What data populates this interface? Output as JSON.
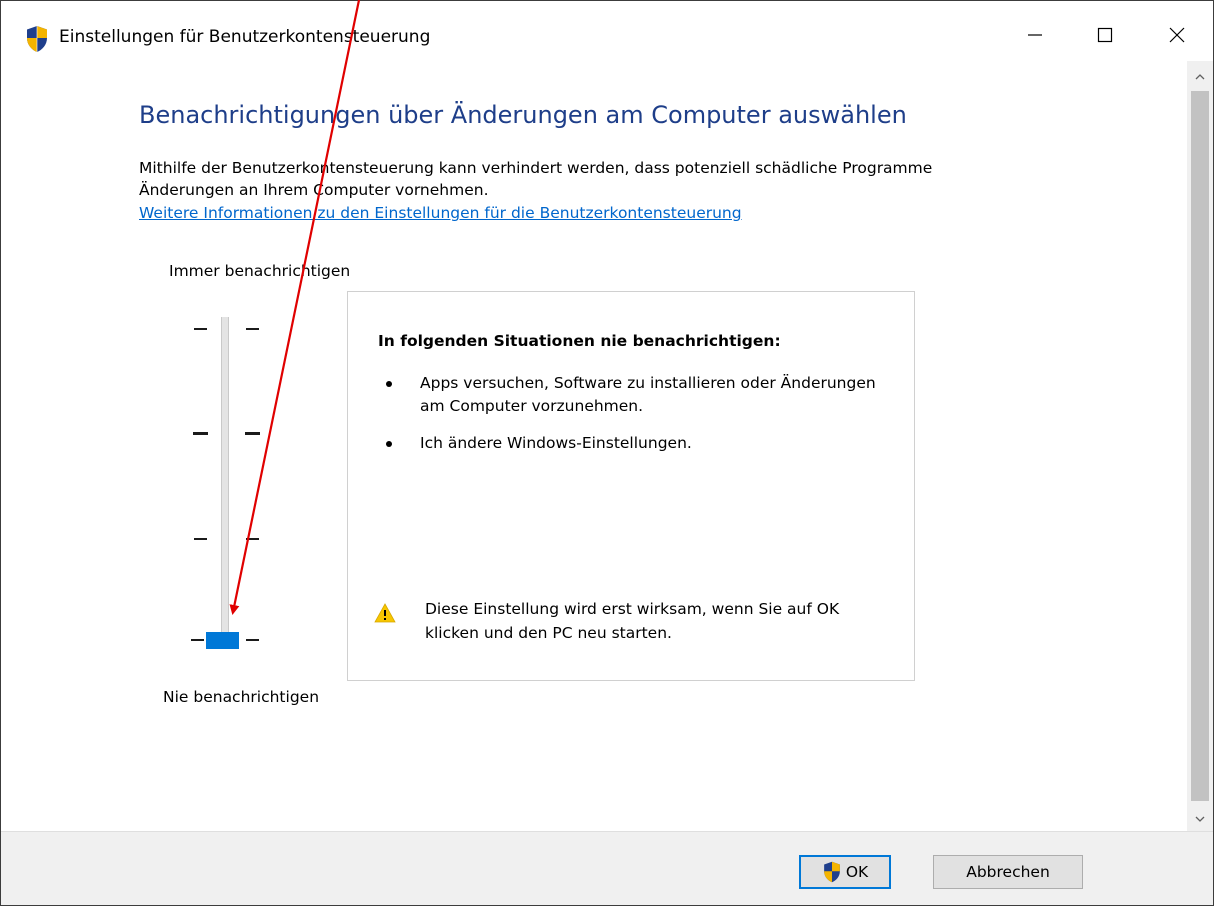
{
  "window": {
    "title": "Einstellungen für Benutzerkontensteuerung",
    "icon": "uac-shield-icon",
    "controls": {
      "minimize": "minimize-icon",
      "maximize": "maximize-icon",
      "close": "close-icon"
    }
  },
  "main": {
    "heading": "Benachrichtigungen über Änderungen am Computer auswählen",
    "description_line1": "Mithilfe der Benutzerkontensteuerung kann verhindert werden, dass potenziell schädliche Programme",
    "description_line2": "Änderungen an Ihrem Computer vornehmen.",
    "link": "Weitere Informationen zu den Einstellungen für die Benutzerkontensteuerung"
  },
  "slider": {
    "top_label": "Immer benachrichtigen",
    "bottom_label": "Nie benachrichtigen",
    "levels": 4,
    "selected_level": 1,
    "thumb_color": "#0078d7"
  },
  "info": {
    "title": "In folgenden Situationen nie benachrichtigen:",
    "items": [
      "Apps versuchen, Software zu installieren oder Änderungen am Computer vorzunehmen.",
      "Ich ändere Windows-Einstellungen."
    ],
    "warning_line1": "Diese Einstellung wird erst wirksam, wenn Sie auf OK",
    "warning_line2": "klicken und den PC neu starten.",
    "warning_icon": "warning-icon"
  },
  "footer": {
    "ok_label": "OK",
    "cancel_label": "Abbrechen"
  },
  "colors": {
    "heading": "#1e3e89",
    "link": "#0066cc",
    "accent": "#0078d7",
    "annotation_arrow": "#e00000"
  }
}
